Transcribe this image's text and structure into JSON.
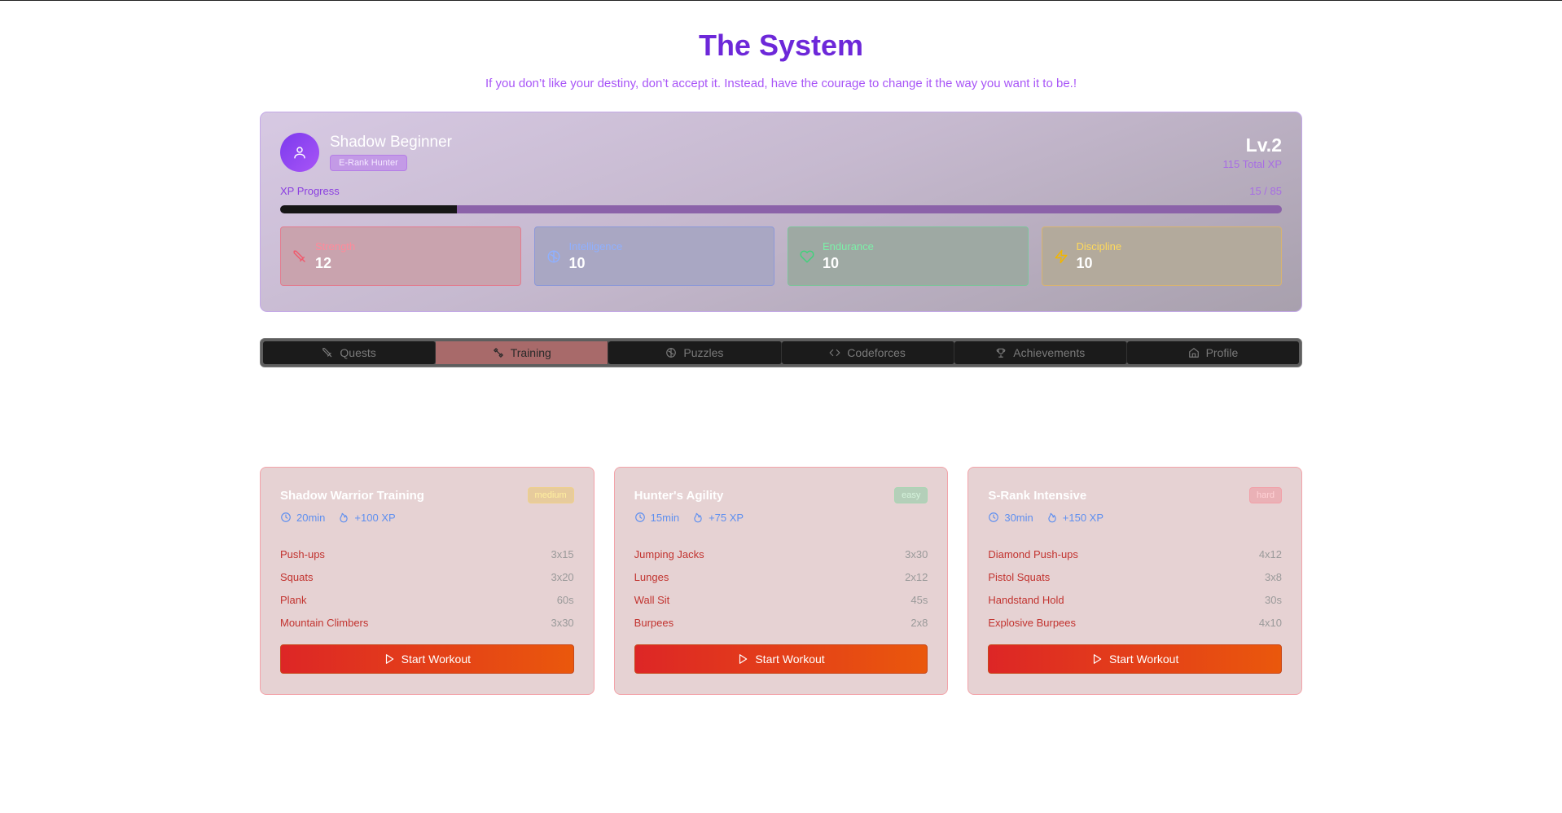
{
  "header": {
    "title": "The System",
    "subtitle": "If you don’t like your destiny, don’t accept it. Instead, have the courage to change it the way you want it to be.!"
  },
  "profile": {
    "name": "Shadow Beginner",
    "rank": "E-Rank Hunter",
    "level": "Lv.2",
    "total_xp": "115 Total XP",
    "xp_label": "XP Progress",
    "xp_value": "15 / 85",
    "xp_current": 15,
    "xp_max": 85,
    "stats": [
      {
        "label": "Strength",
        "value": "12"
      },
      {
        "label": "Intelligence",
        "value": "10"
      },
      {
        "label": "Endurance",
        "value": "10"
      },
      {
        "label": "Discipline",
        "value": "10"
      }
    ]
  },
  "tabs": [
    {
      "label": "Quests",
      "icon": "sword-icon"
    },
    {
      "label": "Training",
      "icon": "dumbbell-icon",
      "active": true
    },
    {
      "label": "Puzzles",
      "icon": "brain-icon"
    },
    {
      "label": "Codeforces",
      "icon": "code-icon"
    },
    {
      "label": "Achievements",
      "icon": "trophy-icon"
    },
    {
      "label": "Profile",
      "icon": "home-icon"
    }
  ],
  "workouts": [
    {
      "title": "Shadow Warrior Training",
      "difficulty": "medium",
      "duration": "20min",
      "xp": "+100 XP",
      "exercises": [
        {
          "name": "Push-ups",
          "reps": "3x15"
        },
        {
          "name": "Squats",
          "reps": "3x20"
        },
        {
          "name": "Plank",
          "reps": "60s"
        },
        {
          "name": "Mountain Climbers",
          "reps": "3x30"
        }
      ],
      "button": "Start Workout"
    },
    {
      "title": "Hunter's Agility",
      "difficulty": "easy",
      "duration": "15min",
      "xp": "+75 XP",
      "exercises": [
        {
          "name": "Jumping Jacks",
          "reps": "3x30"
        },
        {
          "name": "Lunges",
          "reps": "2x12"
        },
        {
          "name": "Wall Sit",
          "reps": "45s"
        },
        {
          "name": "Burpees",
          "reps": "2x8"
        }
      ],
      "button": "Start Workout"
    },
    {
      "title": "S-Rank Intensive",
      "difficulty": "hard",
      "duration": "30min",
      "xp": "+150 XP",
      "exercises": [
        {
          "name": "Diamond Push-ups",
          "reps": "4x12"
        },
        {
          "name": "Pistol Squats",
          "reps": "3x8"
        },
        {
          "name": "Handstand Hold",
          "reps": "30s"
        },
        {
          "name": "Explosive Burpees",
          "reps": "4x10"
        }
      ],
      "button": "Start Workout"
    }
  ],
  "colors": {
    "title": "#6d28d9",
    "accent": "#a855f7",
    "button_start": "#dd2626",
    "button_end": "#ea580c"
  }
}
